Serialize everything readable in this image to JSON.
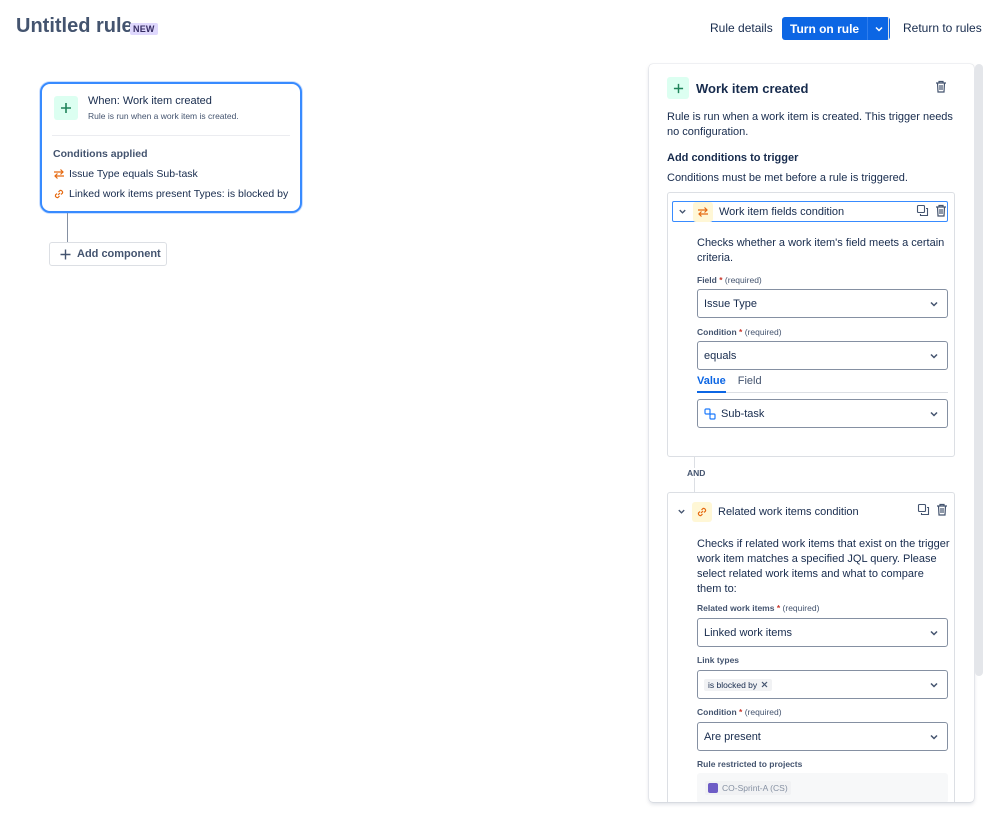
{
  "header": {
    "title": "Untitled rule",
    "badge": "NEW",
    "rule_details": "Rule details",
    "turn_on": "Turn on rule",
    "return": "Return to rules"
  },
  "canvas": {
    "trigger": {
      "title": "When: Work item created",
      "subtitle": "Rule is run when a work item is created."
    },
    "conditions_heading": "Conditions applied",
    "conditions": [
      {
        "text": "Issue Type equals Sub-task",
        "icon": "swap-arrows-icon"
      },
      {
        "text": "Linked work items present Types: is blocked by",
        "icon": "link-icon"
      }
    ],
    "add_component": "Add component"
  },
  "panel": {
    "title": "Work item created",
    "description": "Rule is run when a work item is created. This trigger needs no configuration.",
    "add_conditions": "Add conditions to trigger",
    "must_be_met": "Conditions must be met before a rule is triggered.",
    "condition1": {
      "title": "Work item fields condition",
      "description": "Checks whether a work item's field meets a certain criteria.",
      "field_label": "Field",
      "field_value": "Issue Type",
      "condition_label": "Condition",
      "condition_value": "equals",
      "tabs": [
        "Value",
        "Field"
      ],
      "value": "Sub-task"
    },
    "and_label": "AND",
    "condition2": {
      "title": "Related work items condition",
      "description": "Checks if related work items that exist on the trigger work item matches a specified JQL query. Please select related work items and what to compare them to:",
      "related_label": "Related work items",
      "related_value": "Linked work items",
      "link_types_label": "Link types",
      "link_type_chip": "is blocked by",
      "condition_label": "Condition",
      "condition_value": "Are present",
      "restricted_label": "Rule restricted to projects",
      "project": "CO-Sprint-A (CS)"
    },
    "required_mark": "*",
    "required_text": "(required)"
  },
  "colors": {
    "primary": "#0c66e4",
    "trigger_green": "#dcfff1",
    "condition_yellow": "#fff7d6",
    "badge_purple": "#dfd8fd"
  }
}
